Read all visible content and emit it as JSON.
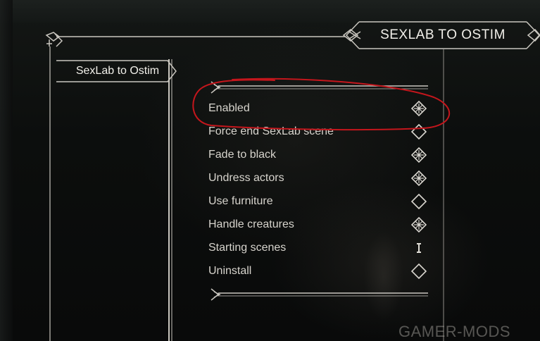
{
  "header": {
    "title": "SEXLAB TO OSTIM"
  },
  "sidebar": {
    "items": [
      {
        "label": "SexLab to Ostim",
        "selected": true
      }
    ]
  },
  "options": [
    {
      "label": "Enabled",
      "control": "toggle",
      "checked": true
    },
    {
      "label": "Force end SexLab scene",
      "control": "toggle",
      "checked": false
    },
    {
      "label": "Fade to black",
      "control": "toggle",
      "checked": true
    },
    {
      "label": "Undress actors",
      "control": "toggle",
      "checked": true
    },
    {
      "label": "Use furniture",
      "control": "toggle",
      "checked": false
    },
    {
      "label": "Handle creatures",
      "control": "toggle",
      "checked": true
    },
    {
      "label": "Starting scenes",
      "control": "text-input"
    },
    {
      "label": "Uninstall",
      "control": "toggle",
      "checked": false
    }
  ],
  "annotation": {
    "color": "#c4161c",
    "target": "Enabled"
  },
  "watermark": {
    "text": "GAMER-MODS"
  },
  "colors": {
    "frame": "#c9c6bf",
    "text": "#d7d4cd",
    "highlight": "#f1efe9"
  }
}
